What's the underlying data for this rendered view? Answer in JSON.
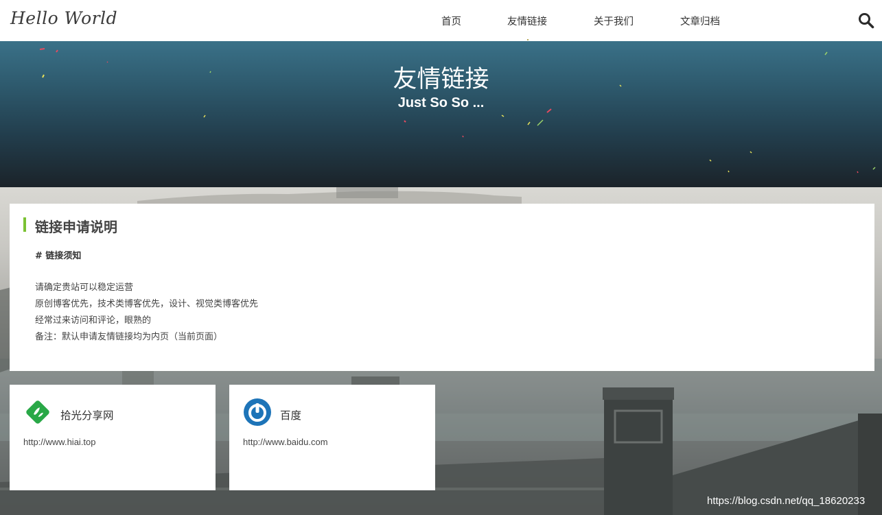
{
  "header": {
    "logo": "Hello World",
    "nav": [
      {
        "label": "首页"
      },
      {
        "label": "友情链接"
      },
      {
        "label": "关于我们"
      },
      {
        "label": "文章归档"
      }
    ],
    "search_icon": "search-icon"
  },
  "hero": {
    "title": "友情链接",
    "subtitle": "Just So So ..."
  },
  "notice": {
    "title": "链接申请说明",
    "heading": "# 链接须知",
    "lines": [
      "请确定贵站可以稳定运营",
      "原创博客优先，技术类博客优先，设计、视觉类博客优先",
      "经常过来访问和评论，眼熟的",
      "备注：默认申请友情链接均为内页（当前页面）"
    ]
  },
  "links": [
    {
      "name": "拾光分享网",
      "url": "http://www.hiai.top",
      "icon": "hiai-logo-icon"
    },
    {
      "name": "百度",
      "url": "http://www.baidu.com",
      "icon": "baidu-logo-icon"
    }
  ],
  "watermark": "https://blog.csdn.net/qq_18620233",
  "colors": {
    "accent": "#7bc233",
    "hero_top": "#3a7188",
    "hero_bottom": "#1b2329",
    "baidu_blue": "#1d74b8",
    "hiai_green": "#29a847"
  }
}
